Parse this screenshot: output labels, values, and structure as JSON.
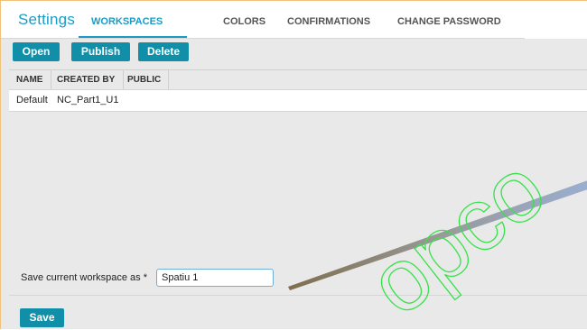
{
  "header": {
    "title": "Settings",
    "tabs": [
      {
        "label": "WORKSPACES",
        "active": true
      },
      {
        "label": "COLORS",
        "active": false
      },
      {
        "label": "CONFIRMATIONS",
        "active": false
      },
      {
        "label": "CHANGE PASSWORD",
        "active": false
      }
    ]
  },
  "toolbar": {
    "open_label": "Open",
    "publish_label": "Publish",
    "delete_label": "Delete"
  },
  "table": {
    "columns": [
      "NAME",
      "CREATED BY",
      "PUBLIC"
    ],
    "rows": [
      {
        "name": "Default",
        "created_by": "NC_Part1_U1",
        "public": ""
      }
    ]
  },
  "save_form": {
    "label": "Save current workspace as *",
    "value": "Spatiu 1",
    "save_label": "Save"
  },
  "overlay": {
    "watermark_text": "opco",
    "watermark_color": "#37e24a"
  },
  "colors": {
    "accent": "#1a9cc6",
    "button": "#128fa8",
    "background": "#e9e9e9"
  }
}
